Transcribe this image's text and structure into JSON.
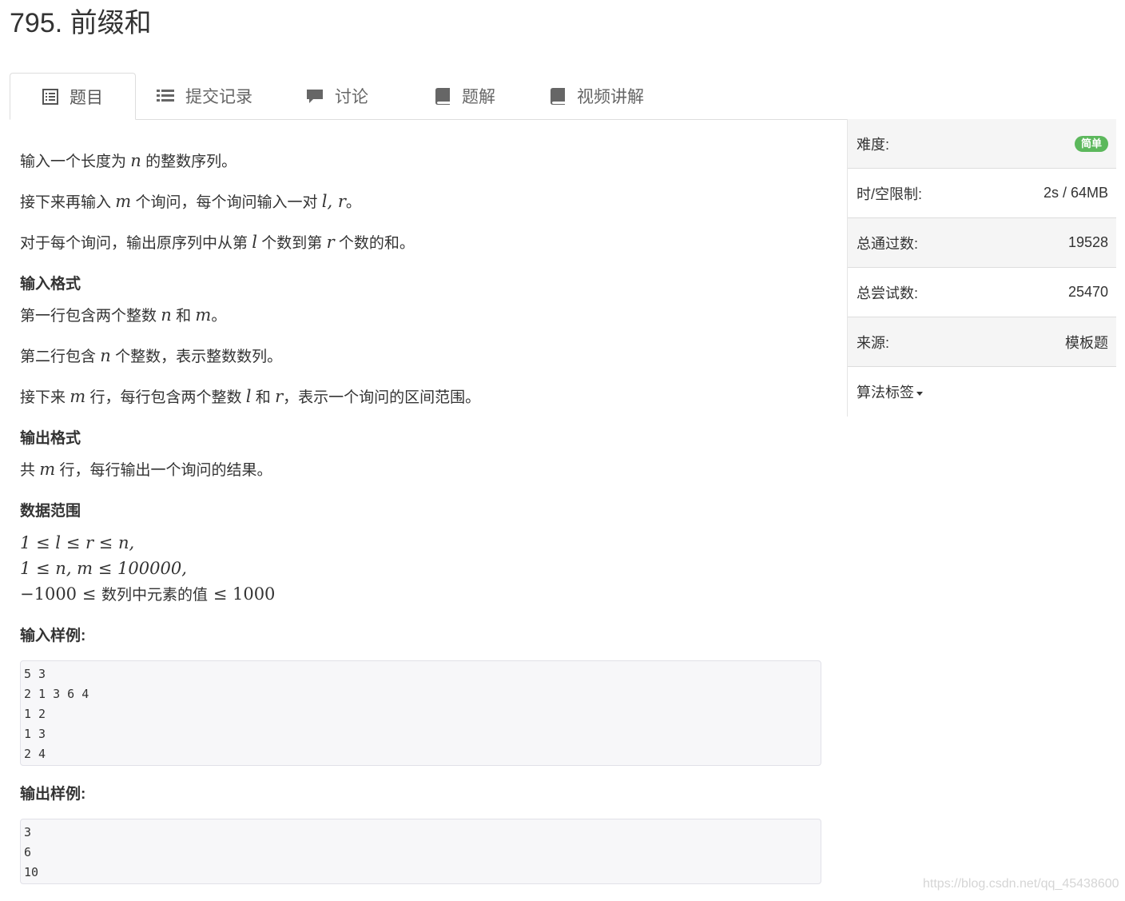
{
  "title": "795. 前缀和",
  "tabs": [
    {
      "label": "题目",
      "icon": "list-alt-icon"
    },
    {
      "label": "提交记录",
      "icon": "list-icon"
    },
    {
      "label": "讨论",
      "icon": "comment-icon"
    },
    {
      "label": "题解",
      "icon": "book-icon"
    },
    {
      "label": "视频讲解",
      "icon": "book-icon"
    }
  ],
  "problem": {
    "desc1_a": "输入一个长度为",
    "desc1_var": "n",
    "desc1_b": "的整数序列。",
    "desc2_a": "接下来再输入",
    "desc2_var": "m",
    "desc2_b": "个询问，每个询问输入一对",
    "desc2_math": "l, r",
    "desc2_c": "。",
    "desc3_a": "对于每个询问，输出原序列中从第",
    "desc3_var1": "l",
    "desc3_b": "个数到第",
    "desc3_var2": "r",
    "desc3_c": "个数的和。",
    "input_heading": "输入格式",
    "in1_a": "第一行包含两个整数",
    "in1_var1": "n",
    "in1_b": "和",
    "in1_var2": "m",
    "in1_c": "。",
    "in2_a": "第二行包含",
    "in2_var": "n",
    "in2_b": "个整数，表示整数数列。",
    "in3_a": "接下来",
    "in3_var1": "m",
    "in3_b": "行，每行包含两个整数",
    "in3_var2": "l",
    "in3_c": "和",
    "in3_var3": "r",
    "in3_d": "，表示一个询问的区间范围。",
    "output_heading": "输出格式",
    "out1_a": "共",
    "out1_var": "m",
    "out1_b": "行，每行输出一个询问的结果。",
    "range_heading": "数据范围",
    "range1": "1 ≤ l ≤ r ≤ n,",
    "range2": "1 ≤ n, m ≤ 100000,",
    "range3_a": "−1000 ≤",
    "range3_cn": "数列中元素的值",
    "range3_b": "≤ 1000",
    "sample_in_heading": "输入样例:",
    "sample_in": [
      "5 3",
      "2 1 3 6 4",
      "1 2",
      "1 3",
      "2 4"
    ],
    "sample_out_heading": "输出样例:",
    "sample_out": [
      "3",
      "6",
      "10"
    ]
  },
  "sidebar": {
    "difficulty_label": "难度:",
    "difficulty_value": "简单",
    "limit_label": "时/空限制:",
    "limit_value": "2s / 64MB",
    "passed_label": "总通过数:",
    "passed_value": "19528",
    "tried_label": "总尝试数:",
    "tried_value": "25470",
    "source_label": "来源:",
    "source_value": "模板题",
    "tags_label": "算法标签"
  },
  "watermark": "https://blog.csdn.net/qq_45438600",
  "colors": {
    "badge": "#5cb85c",
    "code_bg": "#f7f7f9"
  }
}
